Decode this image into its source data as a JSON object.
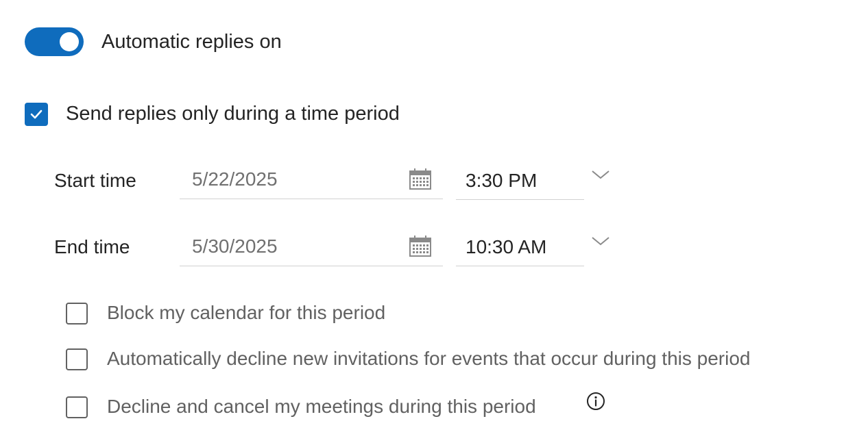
{
  "auto_replies": {
    "toggle_label": "Automatic replies on",
    "toggle_on": true
  },
  "time_period": {
    "checkbox_label": "Send replies only during a time period",
    "checked": true
  },
  "start": {
    "label": "Start time",
    "date": "5/22/2025",
    "time": "3:30 PM"
  },
  "end": {
    "label": "End time",
    "date": "5/30/2025",
    "time": "10:30 AM"
  },
  "options": [
    {
      "label": "Block my calendar for this period",
      "checked": false
    },
    {
      "label": "Automatically decline new invitations for events that occur during this period",
      "checked": false
    },
    {
      "label": "Decline and cancel my meetings during this period",
      "checked": false
    }
  ],
  "colors": {
    "accent": "#0f6cbd",
    "text": "#242424",
    "muted_text": "#616161",
    "placeholder_text": "#707070"
  },
  "icons": {
    "toggle": "toggle-switch",
    "checkmark": "checkmark-icon",
    "calendar": "calendar-icon",
    "dropdown": "chevron-down-icon",
    "info": "info-icon"
  }
}
